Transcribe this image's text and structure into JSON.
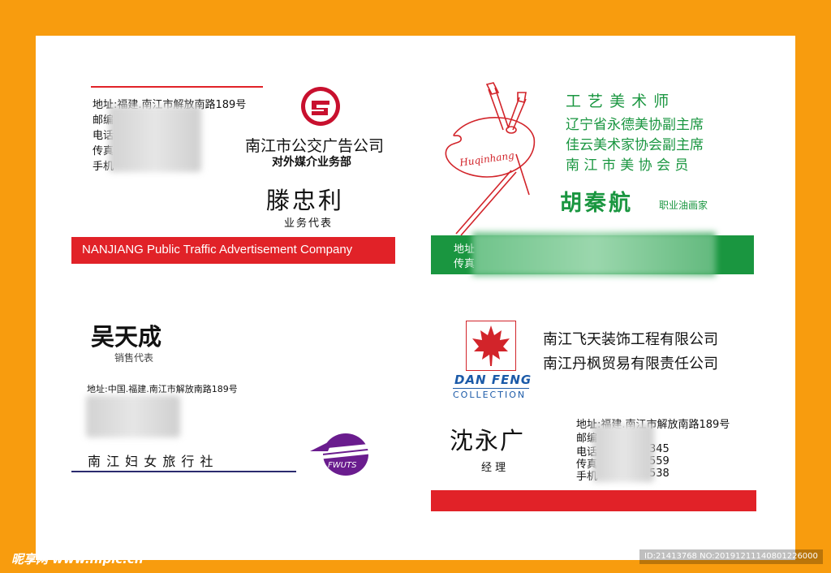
{
  "card1": {
    "address": "地址:福建.南江市解放南路189号",
    "labels": [
      "邮编",
      "电话",
      "传真",
      "手机"
    ],
    "company": "南江市公交广告公司",
    "department": "对外媒介业务部",
    "name": "滕忠利",
    "title": "业务代表",
    "banner": "NANJIANG Public Traffic Advertisement Company",
    "colors": {
      "banner": "#e12228",
      "rule": "#e12228"
    }
  },
  "card2": {
    "titles": [
      "工 艺 美 术 师",
      "辽宁省永德美协副主席",
      "佳云美术家协会副主席",
      "南 江 市 美 协 会 员"
    ],
    "name": "胡秦航",
    "role": "职业油画家",
    "bar_labels": [
      "地址",
      "传真"
    ],
    "palette_text": "Huqinhang",
    "colors": {
      "green": "#1a9640",
      "palette": "#d2242a"
    }
  },
  "card3": {
    "name": "吴天成",
    "title": "销售代表",
    "address": "地址:中国.福建.南江市解放南路189号",
    "company": "南 江 妇 女 旅 行 社",
    "logo_text": "FWUTS",
    "colors": {
      "logo": "#6a1c8e",
      "rule": "#2a2a6e"
    }
  },
  "card4": {
    "companies": [
      "南江飞天装饰工程有限公司",
      "南江丹枫贸易有限责任公司"
    ],
    "logo_top": "DAN FENG",
    "logo_bottom": "COLLECTION",
    "name": "沈永广",
    "title": "经 理",
    "address": "地址:福建.南江市解放南路189号",
    "labels": [
      "邮编",
      "电话",
      "传真",
      "手机"
    ],
    "numbers": [
      "345",
      "559",
      "538"
    ],
    "colors": {
      "bar": "#e12228",
      "logo_blue": "#1b5aa8"
    }
  },
  "watermark": {
    "site": "昵享网 www.nipic.cn",
    "id": "ID:21413768 NO:20191211140801226000"
  }
}
